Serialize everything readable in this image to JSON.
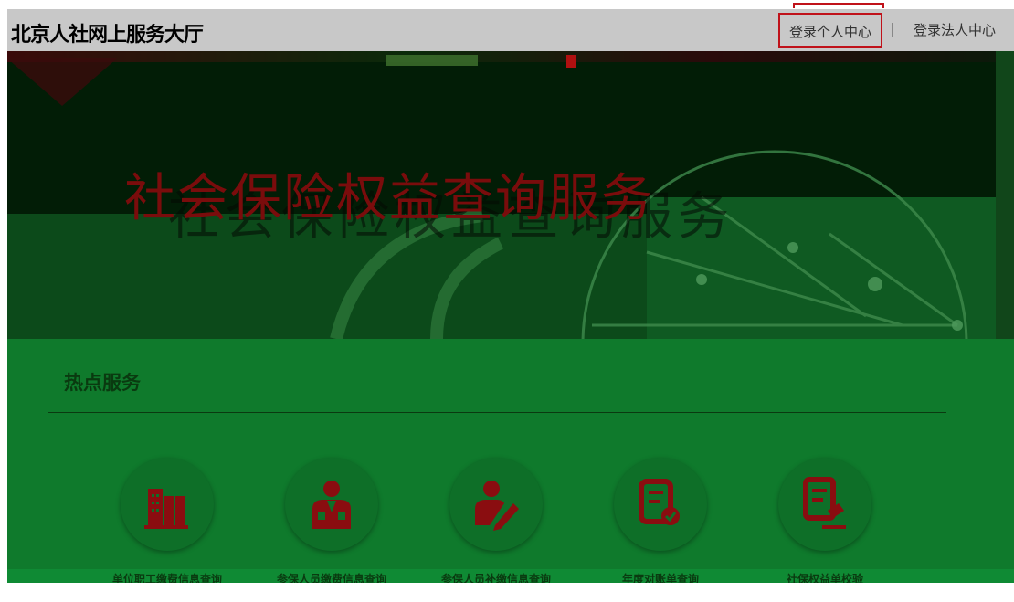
{
  "header": {
    "brand_title": "北京人社网上服务大厅",
    "login_personal": "登录个人中心",
    "login_corporate": "登录法人中心"
  },
  "banner": {
    "title": "社会保险权益查询服务"
  },
  "hot_services": {
    "section_title": "热点服务",
    "items": [
      {
        "label": "单位职工缴费信息查询",
        "icon": "building-icon"
      },
      {
        "label": "参保人员缴费信息查询",
        "icon": "person-suit-icon"
      },
      {
        "label": "参保人员补缴信息查询",
        "icon": "person-edit-icon"
      },
      {
        "label": "年度对账单查询",
        "icon": "document-check-icon"
      },
      {
        "label": "社保权益单校验",
        "icon": "document-gavel-icon"
      }
    ]
  },
  "colors": {
    "accent_red": "#c0121a",
    "icon_red": "#8a0d10",
    "section_green": "#0f7a2c"
  }
}
